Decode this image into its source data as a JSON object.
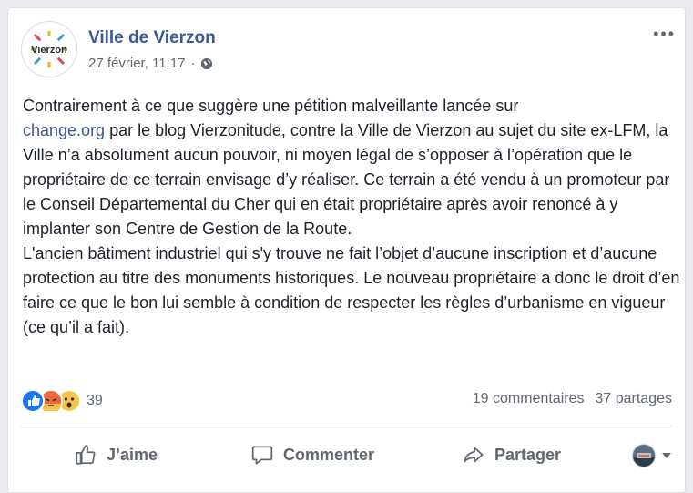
{
  "post": {
    "page_name": "Ville de Vierzon",
    "timestamp": "27 février, 11:17",
    "separator": "·",
    "avatar_text": "Vierzon",
    "body_link": "change.org",
    "body_part1": "Contrairement à ce que suggère une pétition malveillante lancée sur",
    "body_part2": " par le blog Vierzonitude, contre la Ville de Vierzon au sujet du site ex-LFM, la Ville n’a absolument aucun pouvoir, ni moyen légal de s’opposer à l’opération que le propriétaire de ce terrain envisage d’y réaliser. Ce terrain a été vendu à un promoteur par le Conseil Départemental du Cher qui en était propriétaire après avoir renoncé à y implanter son Centre de Gestion de la Route.\nL'ancien bâtiment industriel qui s'y trouve ne fait l’objet d’aucune inscription et d’aucune protection au titre des monuments historiques. Le nouveau propriétaire a donc le droit d’en faire ce que le bon lui semble à condition de respecter les règles d’urbanisme en vigueur (ce qu’il a fait)."
  },
  "stats": {
    "reaction_count": "39",
    "comments": "19 commentaires",
    "shares": "37 partages"
  },
  "actions": {
    "like": "J’aime",
    "comment": "Commenter",
    "share": "Partager"
  },
  "icons": {
    "like_reaction": "thumbs-up",
    "angry_reaction": "angry",
    "wow_reaction": "wow",
    "globe": "globe-icon"
  },
  "colors": {
    "link": "#385898",
    "like_blue": "#1877f2",
    "angry_orange": "#f0663a",
    "wow_yellow": "#f7c44a"
  }
}
